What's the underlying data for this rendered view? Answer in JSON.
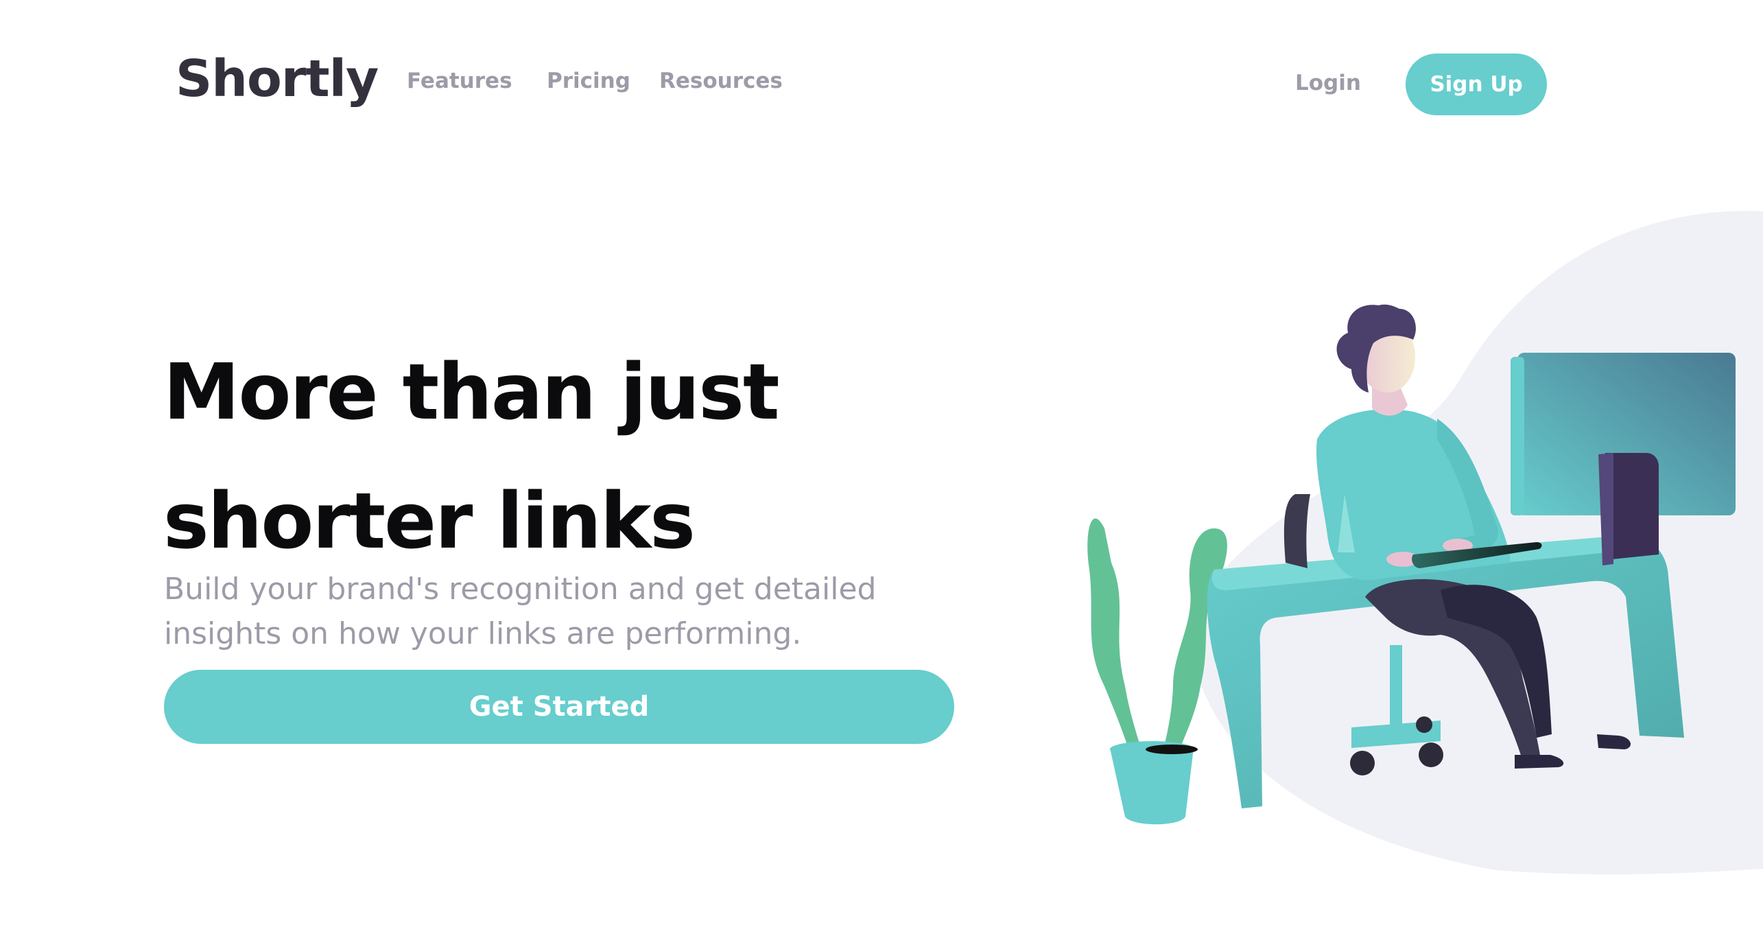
{
  "nav": {
    "logo": "Shortly",
    "links": [
      "Features",
      "Pricing",
      "Resources"
    ],
    "login_label": "Login",
    "signup_label": "Sign Up"
  },
  "hero": {
    "headline_line1": "More than just",
    "headline_line2": "shorter links",
    "subtext_line1": "Build your brand's recognition and get detailed",
    "subtext_line2": "insights on how your links are performing.",
    "cta_label": "Get Started"
  },
  "illustration": {
    "name": "person-working-at-desk-illustration"
  },
  "colors": {
    "accent": "#67cdcd",
    "text_dark": "#0b0a0d",
    "text_muted": "#9e9aa8",
    "logo": "#34313d",
    "blob": "#f0f1f6",
    "purple": "#4b3f6b"
  }
}
